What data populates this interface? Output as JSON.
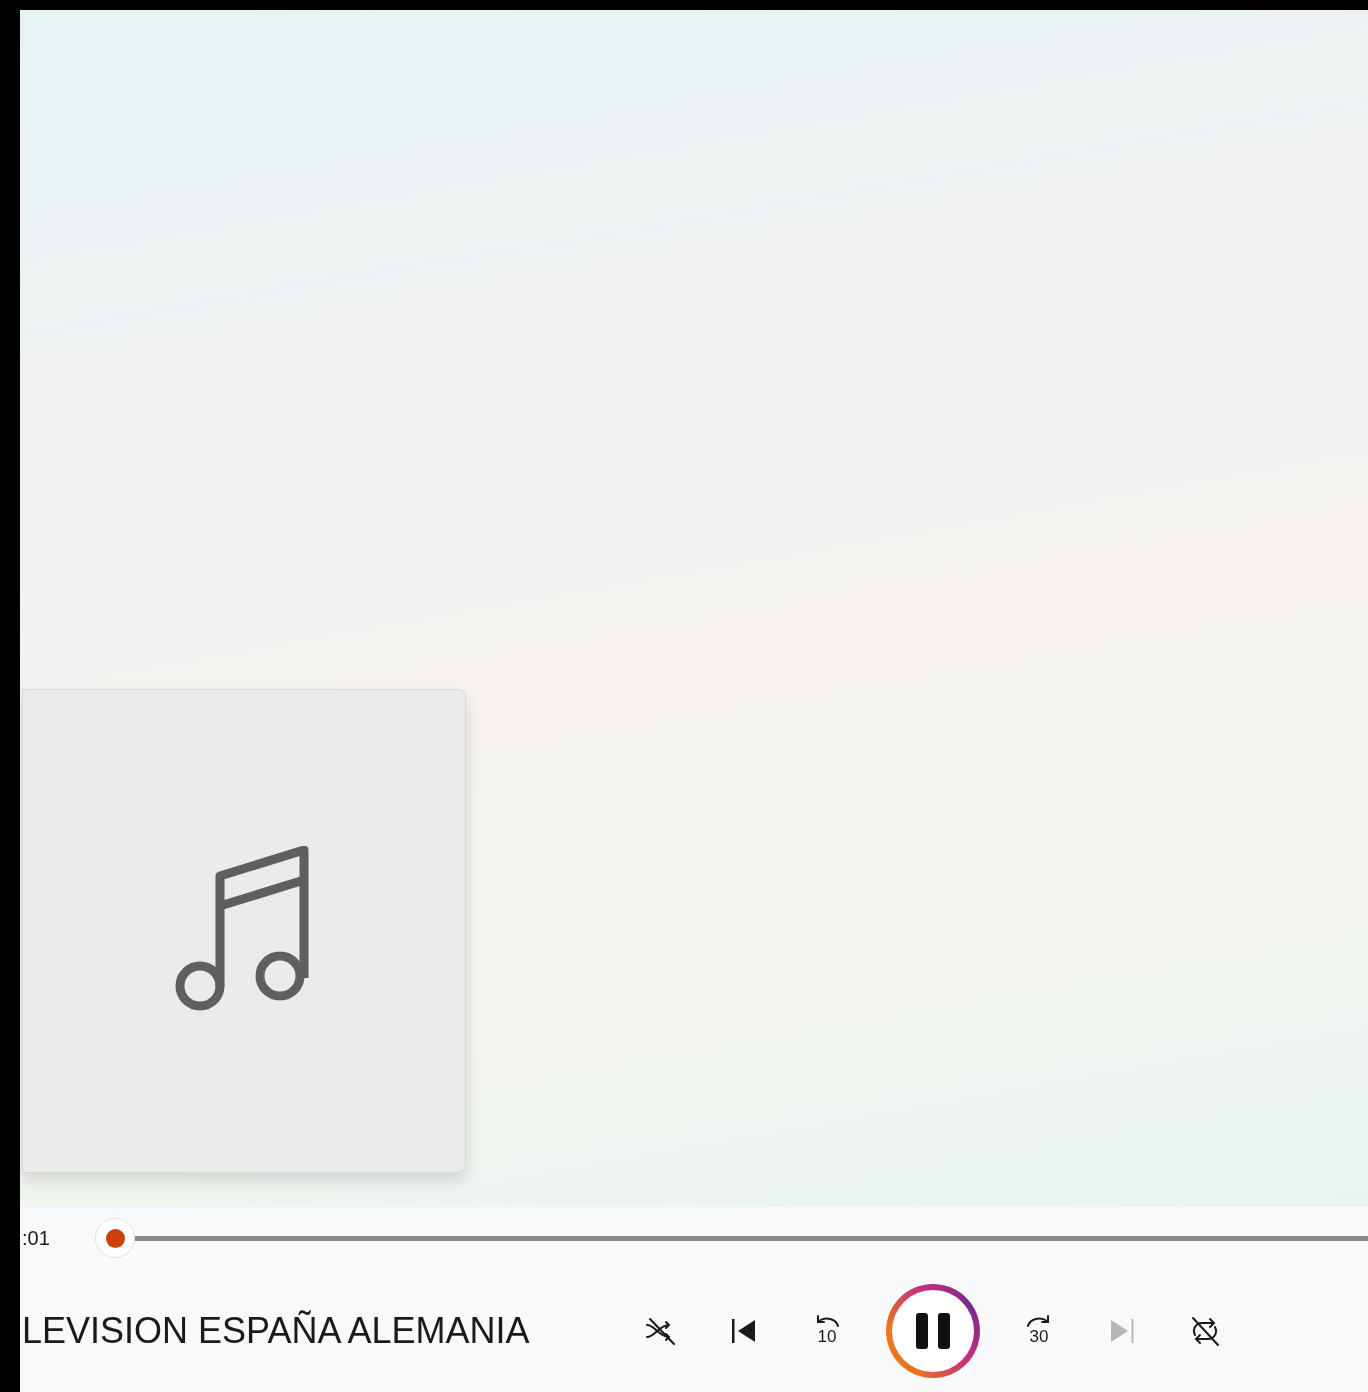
{
  "player": {
    "elapsed": ":01",
    "title": "LEVISION ESPAÑA ALEMANIA",
    "playing": true,
    "shuffle_on": false,
    "repeat_on": false
  },
  "controls": [
    {
      "kind": "shuffle",
      "disabled": false
    },
    {
      "kind": "previous",
      "disabled": false
    },
    {
      "kind": "back",
      "label": "10",
      "disabled": false
    },
    {
      "kind": "playpause",
      "disabled": false
    },
    {
      "kind": "forward",
      "label": "30",
      "disabled": false
    },
    {
      "kind": "next",
      "disabled": true
    },
    {
      "kind": "repeat",
      "disabled": false
    }
  ]
}
